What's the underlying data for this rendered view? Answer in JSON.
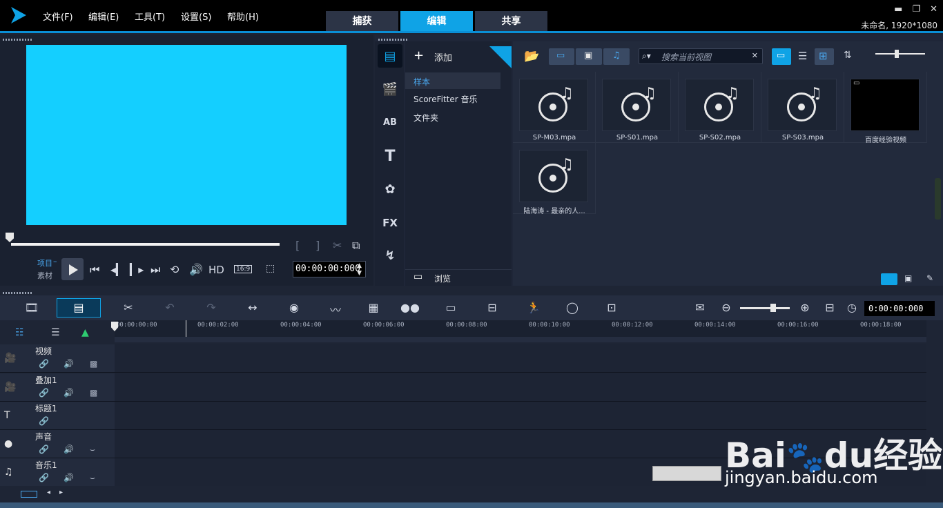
{
  "menu": {
    "items": [
      "文件(F)",
      "编辑(E)",
      "工具(T)",
      "设置(S)",
      "帮助(H)"
    ]
  },
  "mode_tabs": [
    {
      "label": "捕获",
      "active": false
    },
    {
      "label": "编辑",
      "active": true
    },
    {
      "label": "共享",
      "active": false
    }
  ],
  "project_info": "未命名, 1920*1080",
  "player": {
    "project_label": "项目",
    "clip_label": "素材",
    "hd_label": "HD",
    "aspect_label": "16:9",
    "timecode": "00:00:00:000",
    "preview_color": "#14cfff"
  },
  "library": {
    "add_label": "添加",
    "tree": [
      "样本",
      "ScoreFitter 音乐",
      "文件夹"
    ],
    "browse_label": "浏览",
    "search_placeholder": "搜索当前视图",
    "items": [
      {
        "caption": "SP-M03.mpa",
        "type": "audio"
      },
      {
        "caption": "SP-S01.mpa",
        "type": "audio"
      },
      {
        "caption": "SP-S02.mpa",
        "type": "audio"
      },
      {
        "caption": "SP-S03.mpa",
        "type": "audio"
      },
      {
        "caption": "百度经验视频",
        "type": "video"
      },
      {
        "caption": "陆海涛 - 最亲的人...",
        "type": "audio"
      }
    ]
  },
  "timeline": {
    "timecode": "0:00:00:000",
    "ruler": [
      "00:00:00:00",
      "00:00:02:00",
      "00:00:04:00",
      "00:00:06:00",
      "00:00:08:00",
      "00:00:10:00",
      "00:00:12:00",
      "00:00:14:00",
      "00:00:16:00",
      "00:00:18:00"
    ],
    "tracks": [
      {
        "name": "视频",
        "icon": "video-camera-icon"
      },
      {
        "name": "叠加1",
        "icon": "overlay-icon"
      },
      {
        "name": "标题1",
        "icon": "title-icon"
      },
      {
        "name": "声音",
        "icon": "voice-icon"
      },
      {
        "name": "音乐1",
        "icon": "music-icon"
      }
    ]
  },
  "watermark": {
    "brand": "Bai",
    "brand2": "du",
    "suffix": "经验",
    "url": "jingyan.baidu.com"
  },
  "colors": {
    "accent": "#0fa3e6",
    "bg": "#1e2535"
  }
}
